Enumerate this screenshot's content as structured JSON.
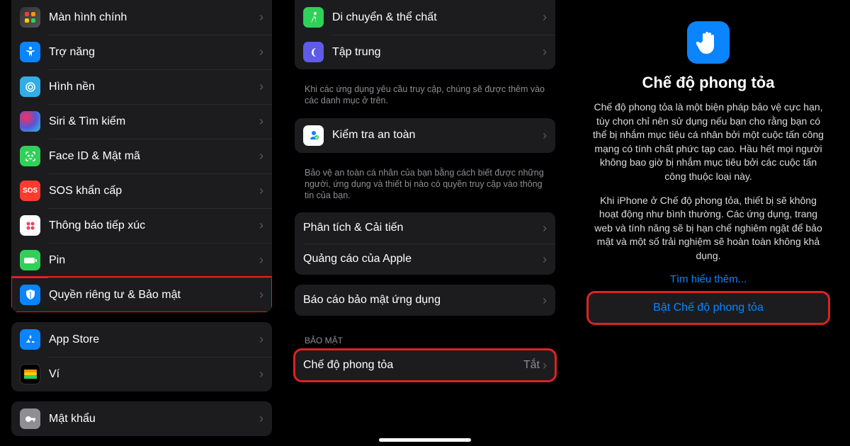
{
  "panel1": {
    "items": [
      {
        "label": "Màn hình chính",
        "iconName": "home-screen-icon",
        "iconBg": "bg-grid"
      },
      {
        "label": "Trợ năng",
        "iconName": "accessibility-icon",
        "iconBg": "bg-blue"
      },
      {
        "label": "Hình nền",
        "iconName": "wallpaper-icon",
        "iconBg": "bg-cyan"
      },
      {
        "label": "Siri & Tìm kiếm",
        "iconName": "siri-icon",
        "iconBg": "siri-bg"
      },
      {
        "label": "Face ID & Mật mã",
        "iconName": "faceid-icon",
        "iconBg": "bg-green"
      },
      {
        "label": "SOS khẩn cấp",
        "iconName": "sos-icon",
        "iconBg": "bg-red"
      },
      {
        "label": "Thông báo tiếp xúc",
        "iconName": "exposure-icon",
        "iconBg": "bg-pink"
      },
      {
        "label": "Pin",
        "iconName": "battery-icon",
        "iconBg": "bg-green"
      },
      {
        "label": "Quyền riêng tư & Bảo mật",
        "iconName": "privacy-icon",
        "iconBg": "bg-blue",
        "highlight": true
      }
    ],
    "group2": [
      {
        "label": "App Store",
        "iconName": "appstore-icon",
        "iconBg": "bg-blue"
      },
      {
        "label": "Ví",
        "iconName": "wallet-icon",
        "iconBg": "bg-black"
      }
    ],
    "group3": [
      {
        "label": "Mật khẩu",
        "iconName": "passwords-icon",
        "iconBg": "bg-gray"
      }
    ]
  },
  "panel2": {
    "top": [
      {
        "label": "Di chuyển & thể chất",
        "iconName": "motion-icon",
        "iconBg": "bg-teal"
      },
      {
        "label": "Tập trung",
        "iconName": "focus-icon",
        "iconBg": "bg-moon"
      }
    ],
    "caption1": "Khi các ứng dụng yêu cầu truy cập, chúng sẽ được thêm vào các danh mục ở trên.",
    "safety": {
      "label": "Kiểm tra an toàn",
      "iconName": "safety-icon",
      "iconBg": "bg-white"
    },
    "caption2": "Bảo vệ an toàn cá nhân của bạn bằng cách biết được những người, ứng dụng và thiết bị nào có quyền truy cập vào thông tin của bạn.",
    "analytics": [
      {
        "label": "Phân tích & Cải tiến"
      },
      {
        "label": "Quảng cáo của Apple"
      }
    ],
    "report": {
      "label": "Báo cáo bảo mật ứng dụng"
    },
    "sectionHeader": "BẢO MẬT",
    "lockdown": {
      "label": "Chế độ phong tỏa",
      "value": "Tắt",
      "highlight": true
    }
  },
  "panel3": {
    "title": "Chế độ phong tỏa",
    "para1": "Chế độ phong tỏa là một biện pháp bảo vệ cực hạn, tùy chọn chỉ nên sử dụng nếu bạn cho rằng bạn có thể bị nhắm mục tiêu cá nhân bởi một cuộc tấn công mạng có tính chất phức tạp cao. Hầu hết mọi người không bao giờ bị nhắm mục tiêu bởi các cuộc tấn công thuộc loại này.",
    "para2": "Khi iPhone ở Chế độ phong tỏa, thiết bị sẽ không hoạt động như bình thường. Các ứng dụng, trang web và tính năng sẽ bị hạn chế nghiêm ngặt để bảo mật và một số trải nghiệm sẽ hoàn toàn không khả dụng.",
    "learnMore": "Tìm hiểu thêm...",
    "enable": "Bật Chế độ phong tỏa"
  }
}
